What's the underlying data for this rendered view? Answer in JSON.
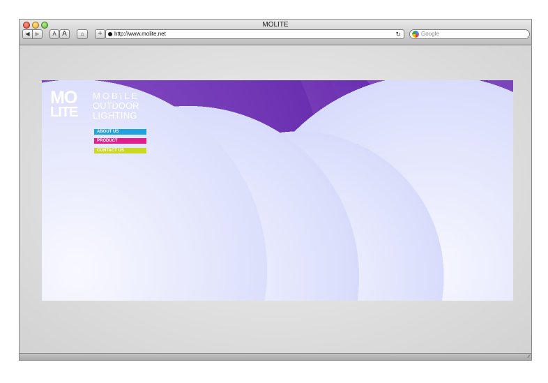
{
  "window": {
    "title": "MOLITE"
  },
  "toolbar": {
    "back_icon": "◀",
    "forward_icon": "▶",
    "text_smaller_label": "A",
    "text_larger_label": "A",
    "home_icon": "⌂",
    "add_icon": "+",
    "url": "http://www.molite.net",
    "reload_icon": "↻",
    "search_placeholder": "Google"
  },
  "site": {
    "logo_top": "MO",
    "logo_bottom": "LITE",
    "tagline": [
      "MOBILE",
      "OUTDOOR",
      "LIGHTING"
    ],
    "menu": [
      {
        "label": "ABOUT US",
        "color": "#1fa3df"
      },
      {
        "label": "PRODUCT",
        "color": "#e01f8a"
      },
      {
        "label": "CONTACT US",
        "color": "#cad822"
      }
    ]
  }
}
